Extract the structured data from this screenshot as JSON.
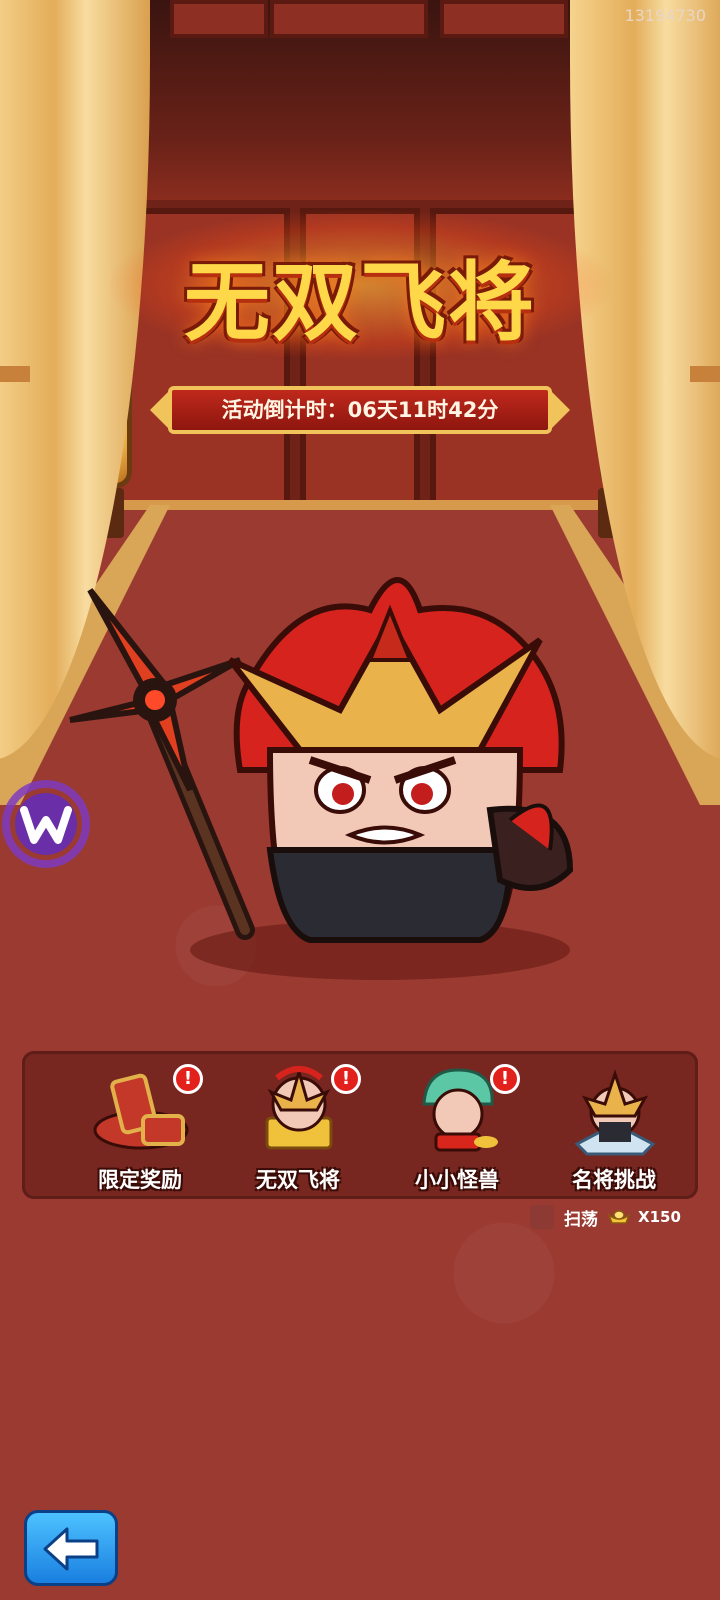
{
  "build_id": "13194730",
  "event": {
    "title": "无双飞将",
    "countdown_label": "活动倒计时：06天11时42分"
  },
  "menu": {
    "items": [
      {
        "label": "限定奖励",
        "badge": "!",
        "icon": "reward-chest-icon"
      },
      {
        "label": "无双飞将",
        "badge": "!",
        "icon": "hero-with-gold-icon"
      },
      {
        "label": "小小怪兽",
        "badge": "!",
        "icon": "dino-costume-hero-icon"
      },
      {
        "label": "名将挑战",
        "badge": "",
        "icon": "general-challenge-icon"
      }
    ]
  },
  "sweep": {
    "label": "扫荡",
    "cost": "X150",
    "currency_icon": "gold-ingot-icon"
  },
  "colors": {
    "carpet": "#9b3a31",
    "title_gold": "#ffd84a",
    "badge_red": "#e3211c",
    "back_button_blue": "#1a7fe0"
  }
}
